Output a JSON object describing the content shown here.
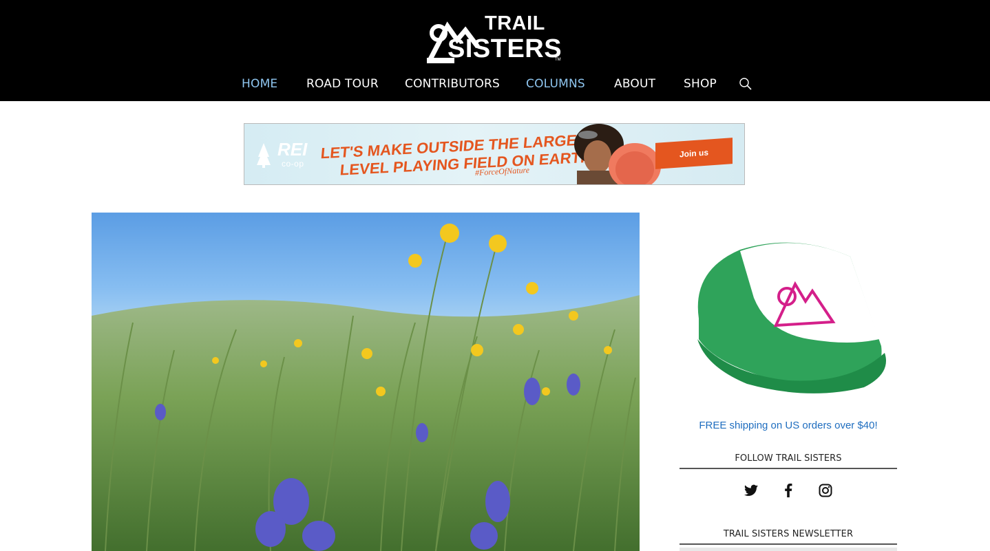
{
  "header": {
    "logo": {
      "line1": "TRAIL",
      "line2": "SISTERS",
      "tm": "TM"
    },
    "nav": [
      {
        "label": "HOME",
        "active": true
      },
      {
        "label": "ROAD TOUR",
        "active": false
      },
      {
        "label": "CONTRIBUTORS",
        "active": false
      },
      {
        "label": "COLUMNS",
        "active": true
      },
      {
        "label": "ABOUT",
        "active": false
      },
      {
        "label": "SHOP",
        "active": false
      }
    ],
    "search_icon": "search-icon"
  },
  "banner": {
    "brand": "REI",
    "brand_sub": "co-op",
    "line1": "LET'S MAKE OUTSIDE THE LARGEST",
    "line2": "LEVEL PLAYING FIELD ON EARTH.",
    "hashtag": "#ForceOfNature",
    "cta": "Join us"
  },
  "sidebar": {
    "shipping_text": "FREE shipping on US orders over $40!",
    "follow_title": "FOLLOW TRAIL SISTERS",
    "social": [
      {
        "icon": "twitter-icon"
      },
      {
        "icon": "facebook-icon"
      },
      {
        "icon": "instagram-icon"
      }
    ],
    "newsletter_title": "TRAIL SISTERS NEWSLETTER"
  },
  "colors": {
    "header_bg": "#000000",
    "nav_active": "#8fc6f0",
    "link_blue": "#1e6dbf",
    "rei_orange": "#e4561f",
    "hat_green": "#2fa35a",
    "logo_magenta": "#d41f8a"
  }
}
